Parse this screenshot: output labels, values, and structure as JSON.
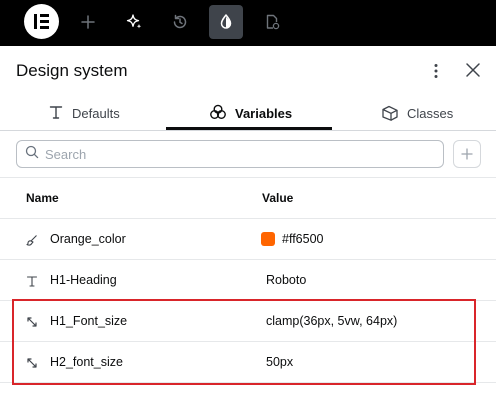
{
  "toolbar": {
    "logo": "elementor-logo-icon",
    "buttons": [
      {
        "name": "add-element-icon",
        "active": false
      },
      {
        "name": "ai-sparkle-icon",
        "active": false
      },
      {
        "name": "history-icon",
        "active": false
      },
      {
        "name": "color-drop-icon",
        "active": true
      },
      {
        "name": "page-settings-icon",
        "active": false
      }
    ]
  },
  "panel": {
    "title": "Design system",
    "tabs": [
      {
        "label": "Defaults",
        "icon": "typography-icon",
        "active": false
      },
      {
        "label": "Variables",
        "icon": "variables-icon",
        "active": true
      },
      {
        "label": "Classes",
        "icon": "classes-icon",
        "active": false
      }
    ],
    "search": {
      "placeholder": "Search",
      "value": ""
    }
  },
  "table": {
    "headers": {
      "name": "Name",
      "value": "Value"
    },
    "rows": [
      {
        "name": "Orange_color",
        "value": "#ff6500",
        "icon": "brush-icon",
        "swatch": "#ff6500"
      },
      {
        "name": "H1-Heading",
        "value": "Roboto",
        "icon": "text-t-icon"
      },
      {
        "name": "H1_Font_size",
        "value": "clamp(36px, 5vw, 64px)",
        "icon": "resize-arrows-icon"
      },
      {
        "name": "H2_font_size",
        "value": "50px",
        "icon": "resize-arrows-icon"
      }
    ]
  },
  "colors": {
    "highlight": "#d9252a",
    "accent_swatch": "#ff6500",
    "toolbar_bg": "#000000"
  }
}
